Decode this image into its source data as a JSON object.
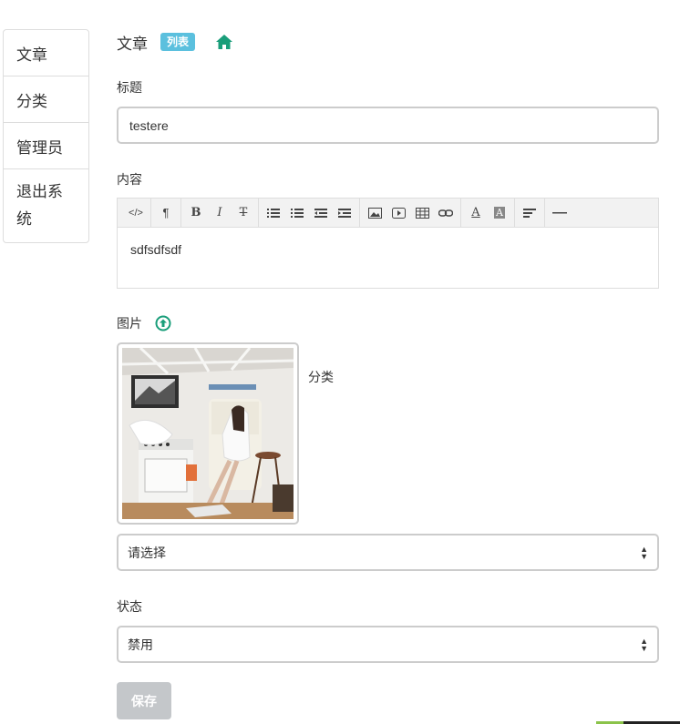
{
  "sidebar": {
    "items": [
      {
        "label": "文章"
      },
      {
        "label": "分类"
      },
      {
        "label": "管理员"
      },
      {
        "label": "退出系统"
      }
    ]
  },
  "header": {
    "title": "文章",
    "badge": "列表",
    "home_icon": "home-icon"
  },
  "form": {
    "title_label": "标题",
    "title_value": "testere",
    "content_label": "内容",
    "content_value": "sdfsdfsdf",
    "image_label": "图片",
    "upload_icon": "upload-icon",
    "category_label": "分类",
    "category_value": "请选择",
    "status_label": "状态",
    "status_value": "禁用",
    "save_label": "保存"
  },
  "toolbar": {
    "buttons": [
      "code-view",
      "paragraph",
      "bold",
      "italic",
      "strikethrough",
      "unordered-list",
      "ordered-list",
      "outdent",
      "indent",
      "image",
      "video",
      "table",
      "link",
      "font-color",
      "background-color",
      "align",
      "horizontal-rule"
    ]
  },
  "colors": {
    "accent": "#1a9e7a",
    "badge": "#5bc0de",
    "save_disabled": "#c4c7ca"
  }
}
